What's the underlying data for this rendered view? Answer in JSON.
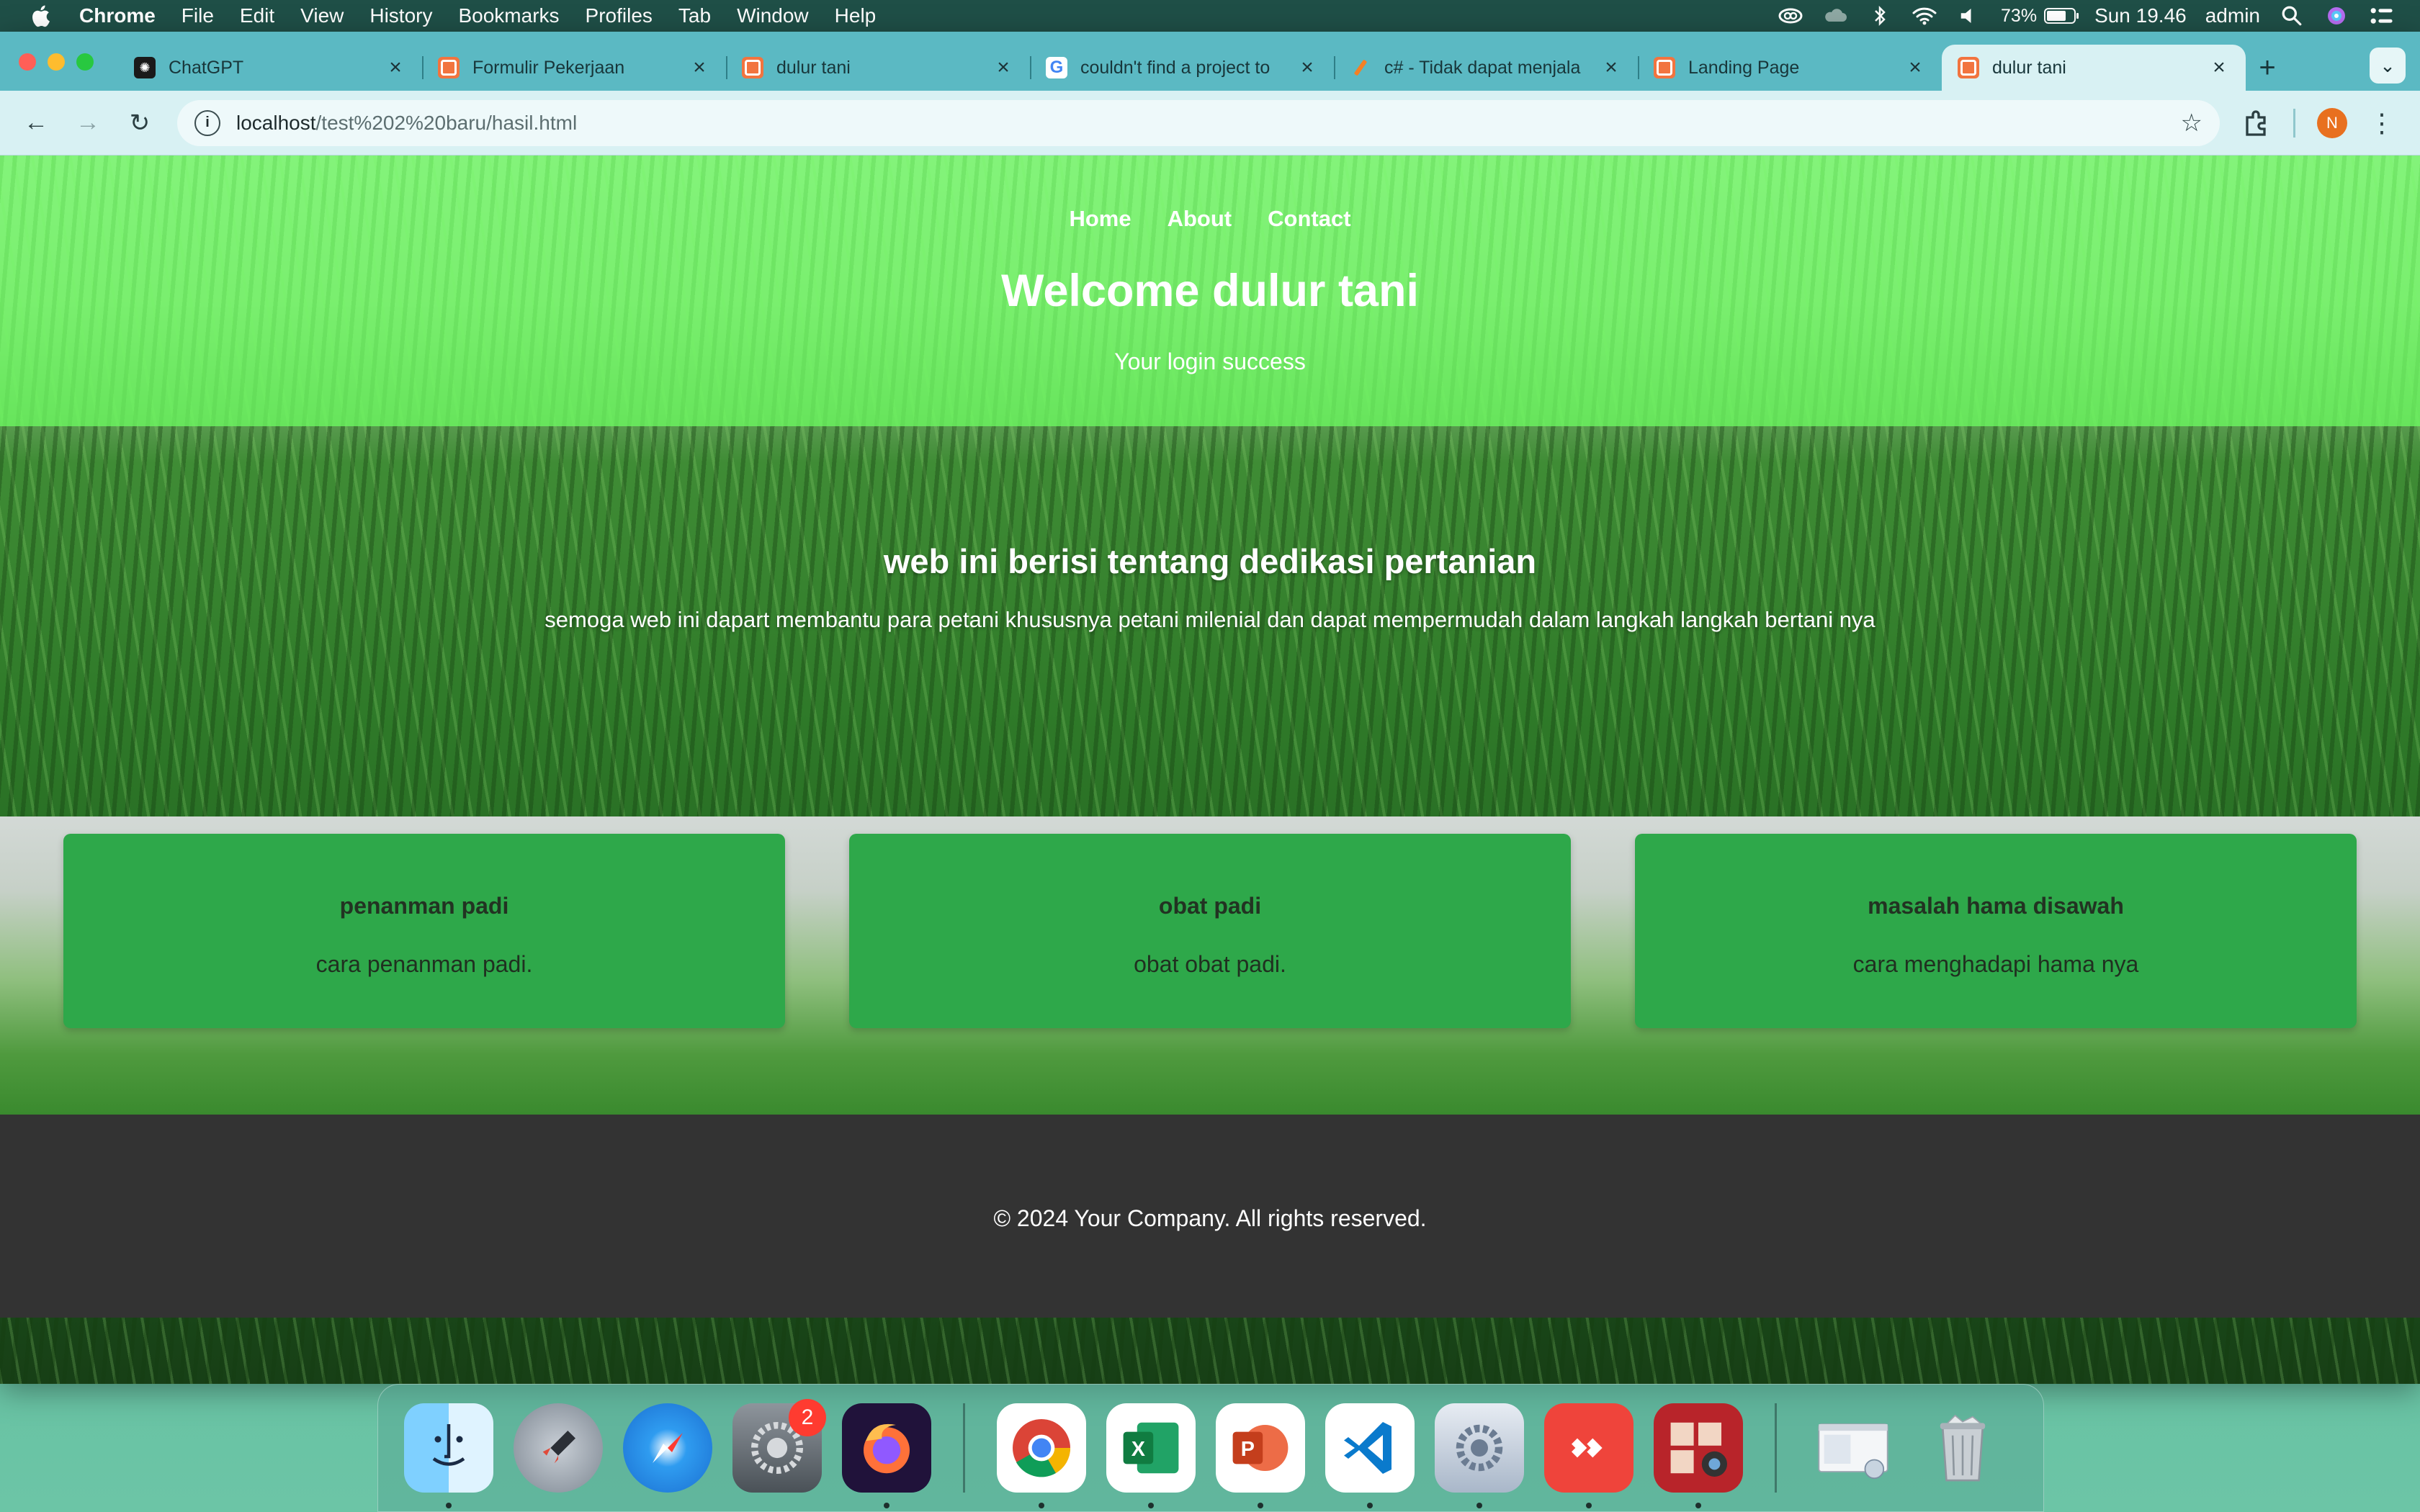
{
  "menubar": {
    "app_name": "Chrome",
    "items": [
      "File",
      "Edit",
      "View",
      "History",
      "Bookmarks",
      "Profiles",
      "Tab",
      "Window",
      "Help"
    ],
    "battery_percent": "73%",
    "battery_level": 0.73,
    "clock": "Sun 19.46",
    "user": "admin"
  },
  "browser": {
    "tabs": [
      {
        "title": "ChatGPT",
        "favicon": "chatgpt-icon"
      },
      {
        "title": "Formulir Pekerjaan",
        "favicon": "xampp-icon"
      },
      {
        "title": "dulur tani",
        "favicon": "xampp-icon"
      },
      {
        "title": "couldn't find a project to",
        "favicon": "google-icon"
      },
      {
        "title": "c# - Tidak dapat menjala",
        "favicon": "stackoverflow-icon"
      },
      {
        "title": "Landing Page",
        "favicon": "xampp-icon"
      },
      {
        "title": "dulur tani",
        "favicon": "xampp-icon",
        "active": true
      }
    ],
    "address": {
      "host": "localhost",
      "path": "/test%202%20baru/hasil.html"
    },
    "profile_initial": "N"
  },
  "site": {
    "nav": [
      "Home",
      "About",
      "Contact"
    ],
    "hero_title": "Welcome dulur tani",
    "hero_subtitle": "Your login success",
    "about_title": "web ini berisi tentang dedikasi pertanian",
    "about_text": "semoga web ini dapart membantu para petani khususnya petani milenial dan dapat mempermudah dalam langkah langkah bertani nya",
    "cards": [
      {
        "title": "penanman padi",
        "text": "cara penanman padi."
      },
      {
        "title": "obat padi",
        "text": "obat obat padi."
      },
      {
        "title": "masalah hama disawah",
        "text": "cara menghadapi hama nya"
      }
    ],
    "footer": "© 2024 Your Company. All rights reserved."
  },
  "dock": {
    "apps": [
      "finder-icon",
      "launchpad-icon",
      "safari-icon",
      "system-settings-icon",
      "firefox-icon",
      "chrome-icon",
      "excel-icon",
      "powerpoint-icon",
      "vscode-icon",
      "xampp-manager-icon",
      "anydesk-icon",
      "photo-booth-icon",
      "preview-window-icon",
      "trash-icon"
    ],
    "settings_badge": "2"
  },
  "colors": {
    "hero_overlay": "#6cfa60",
    "card_bg": "#2ea84a",
    "footer_bg": "#333333",
    "tabstrip": "#5bb9c3",
    "toolbar": "#d8f1f3"
  }
}
